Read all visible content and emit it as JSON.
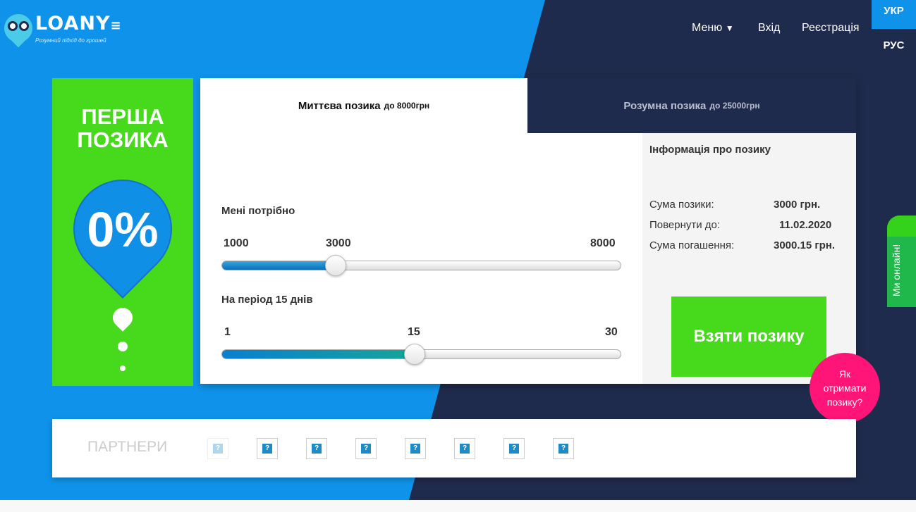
{
  "header": {
    "logo_text": "LOANY",
    "logo_tagline": "Розумний підхід до грошей",
    "nav": {
      "menu": "Меню",
      "login": "Вхід",
      "register": "Реєстрація"
    },
    "lang": {
      "ukr": "УКР",
      "rus": "РУС"
    }
  },
  "promo": {
    "title_line1": "ПЕРША",
    "title_line2": "ПОЗИКА",
    "rate": "0%"
  },
  "tabs": [
    {
      "label": "Миттєва позика",
      "suffix": "до 8000грн",
      "active": true
    },
    {
      "label": "Розумна позика",
      "suffix": "до 25000грн",
      "active": false
    }
  ],
  "calculator": {
    "amount": {
      "label": "Мені потрібно",
      "min": "1000",
      "value": "3000",
      "max": "8000",
      "fraction": 0.2857
    },
    "period": {
      "label": "На період 15 днів",
      "min": "1",
      "value": "15",
      "max": "30",
      "fraction": 0.4828
    }
  },
  "info": {
    "title": "Інформація про позику",
    "rows": [
      {
        "label": "Сума позики:",
        "value": "3000 грн."
      },
      {
        "label": "Повернути до:",
        "value": "11.02.2020"
      },
      {
        "label": "Сума погашення:",
        "value": "3000.15 грн."
      }
    ],
    "button": "Взяти позику"
  },
  "online_widget": "Ми онлайн!",
  "how_to": "Як отримати позику?",
  "partners": {
    "title": "ПАРТНЕРИ",
    "logo_icon": "broken-image-icon"
  },
  "colors": {
    "blue": "#0f93ea",
    "navy": "#1f2b4c",
    "green": "#47d91c",
    "pink": "#ff1477"
  }
}
